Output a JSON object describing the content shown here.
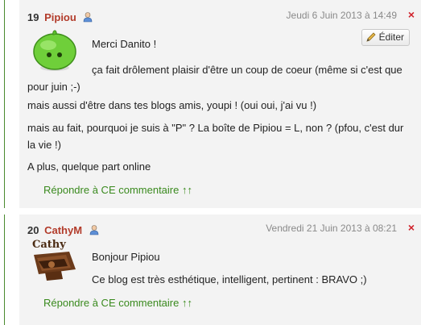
{
  "comments": [
    {
      "number": "19",
      "author": "Pipiou",
      "date": "Jeudi 6 Juin 2013 à 14:49",
      "edit_label": "Éditer",
      "delete_label": "×",
      "paragraphs": [
        "Merci Danito !",
        "ça fait drôlement plaisir d'être un coup de coeur (même si c'est que pour juin ;-)",
        "mais aussi d'être dans tes blogs amis, youpi !  (oui oui, j'ai vu !)",
        "mais au fait, pourquoi je suis à \"P\" ? La boîte de Pipiou = L, non ? (pfou, c'est dur la vie !)",
        "A plus, quelque part online"
      ],
      "reply_label": "Répondre à CE commentaire ↑↑"
    },
    {
      "number": "20",
      "author": "CathyM",
      "date": "Vendredi 21 Juin 2013 à 08:21",
      "delete_label": "×",
      "avatar_text": "Cathy",
      "paragraphs": [
        "Bonjour Pipiou",
        "Ce blog est très esthétique, intelligent, pertinent  : BRAVO ;)"
      ],
      "reply_label": "Répondre à CE commentaire ↑↑"
    }
  ],
  "colors": {
    "author": "#b23b2a",
    "reply_link": "#3a8a1e",
    "delete": "#d0212a",
    "date": "#8a8a8a",
    "comment_bg": "#f3f3f3"
  },
  "icons": [
    "user-icon",
    "pencil-icon",
    "delete-icon"
  ]
}
